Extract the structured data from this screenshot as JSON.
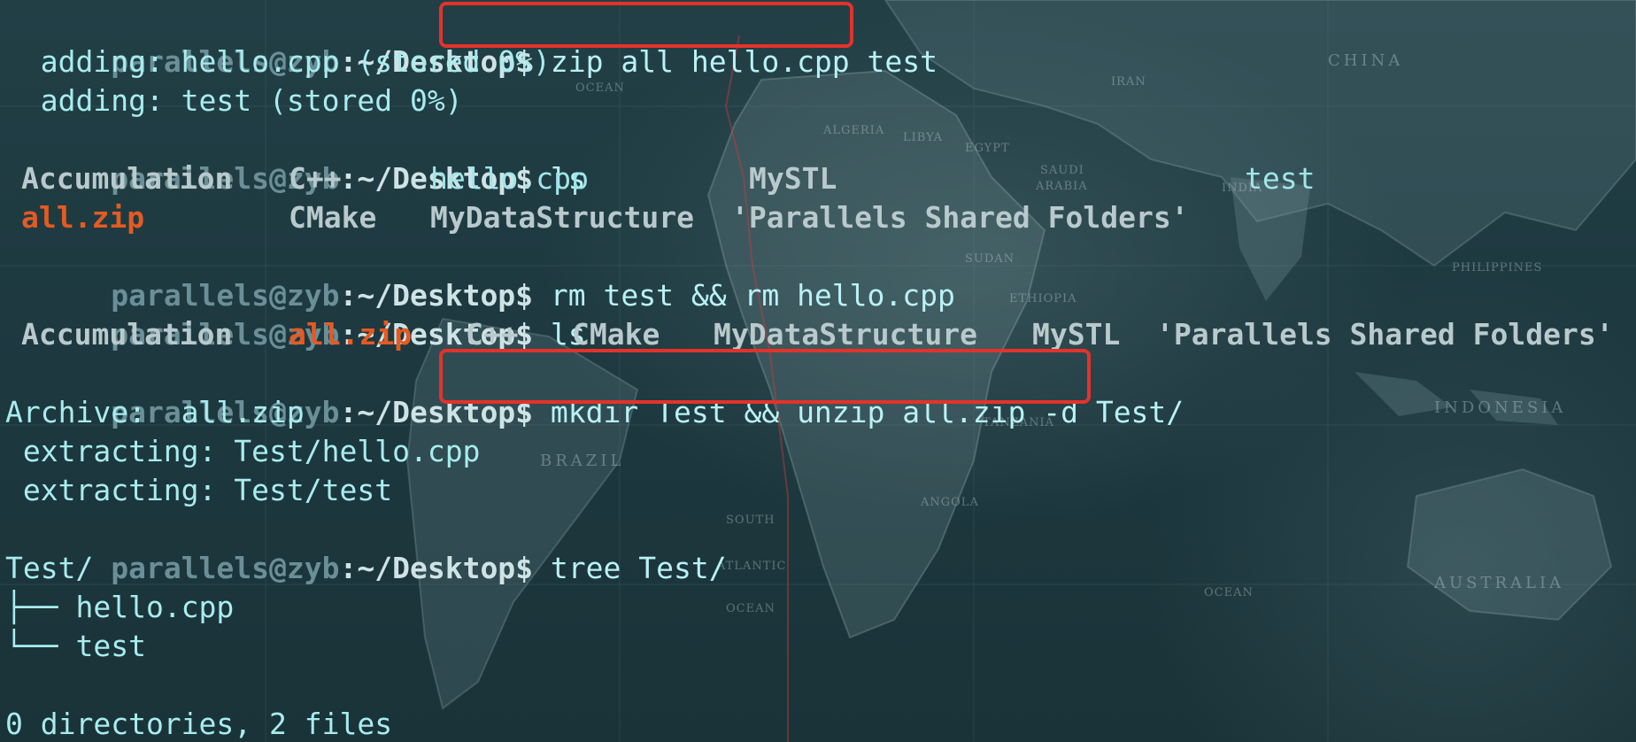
{
  "prompt": {
    "user": "parallels@zyb",
    "path": ":~/Desktop$"
  },
  "lines": {
    "cmd1": "zip all hello.cpp test",
    "out1": "  adding: hello.cpp (stored 0%)",
    "out2": "  adding: test (stored 0%)",
    "cmd2": "ls",
    "ls1": {
      "row1": [
        "Accumulation",
        "C++",
        "hello.cpp",
        "MySTL",
        "test"
      ],
      "row2": [
        "all.zip",
        "CMake",
        "MyDataStructure",
        "'Parallels Shared Folders'"
      ]
    },
    "cmd3": "rm test && rm hello.cpp",
    "cmd4": "ls",
    "ls2": [
      "Accumulation",
      "all.zip",
      "C++",
      "CMake",
      "MyDataStructure",
      "MySTL",
      "'Parallels Shared Folders'"
    ],
    "cmd5": "mkdir Test && unzip all.zip -d Test/",
    "out3": "Archive:  all.zip",
    "out4": " extracting: Test/hello.cpp",
    "out5": " extracting: Test/test",
    "cmd6": "tree Test/",
    "tree_root": "Test/",
    "tree_item1": "├── hello.cpp",
    "tree_item2": "└── test",
    "tree_summary": "0 directories, 2 files"
  },
  "colors": {
    "highlight_box": "#e4322b",
    "zip_file": "#e55a22",
    "text": "#9fe6ea"
  },
  "map_labels": {
    "china": "CHINA",
    "iran": "IRAN",
    "ocean1": "OCEAN",
    "algeria": "ALGERIA",
    "libya": "LIBYA",
    "egypt": "EGYPT",
    "saudi": "SAUDI",
    "arabia": "ARABIA",
    "india": "INDIA",
    "sudan": "SUDAN",
    "ethiopia": "ETHIOPIA",
    "philippines": "PHILIPPINES",
    "brazil": "BRAZIL",
    "indonesia": "INDONESIA",
    "south": "SOUTH",
    "atlantic": "ATLANTIC",
    "ocean2": "OCEAN",
    "australia": "AUSTRALIA",
    "ocean3": "OCEAN",
    "tanzania": "TANZANIA",
    "angola": "ANGOLA"
  }
}
